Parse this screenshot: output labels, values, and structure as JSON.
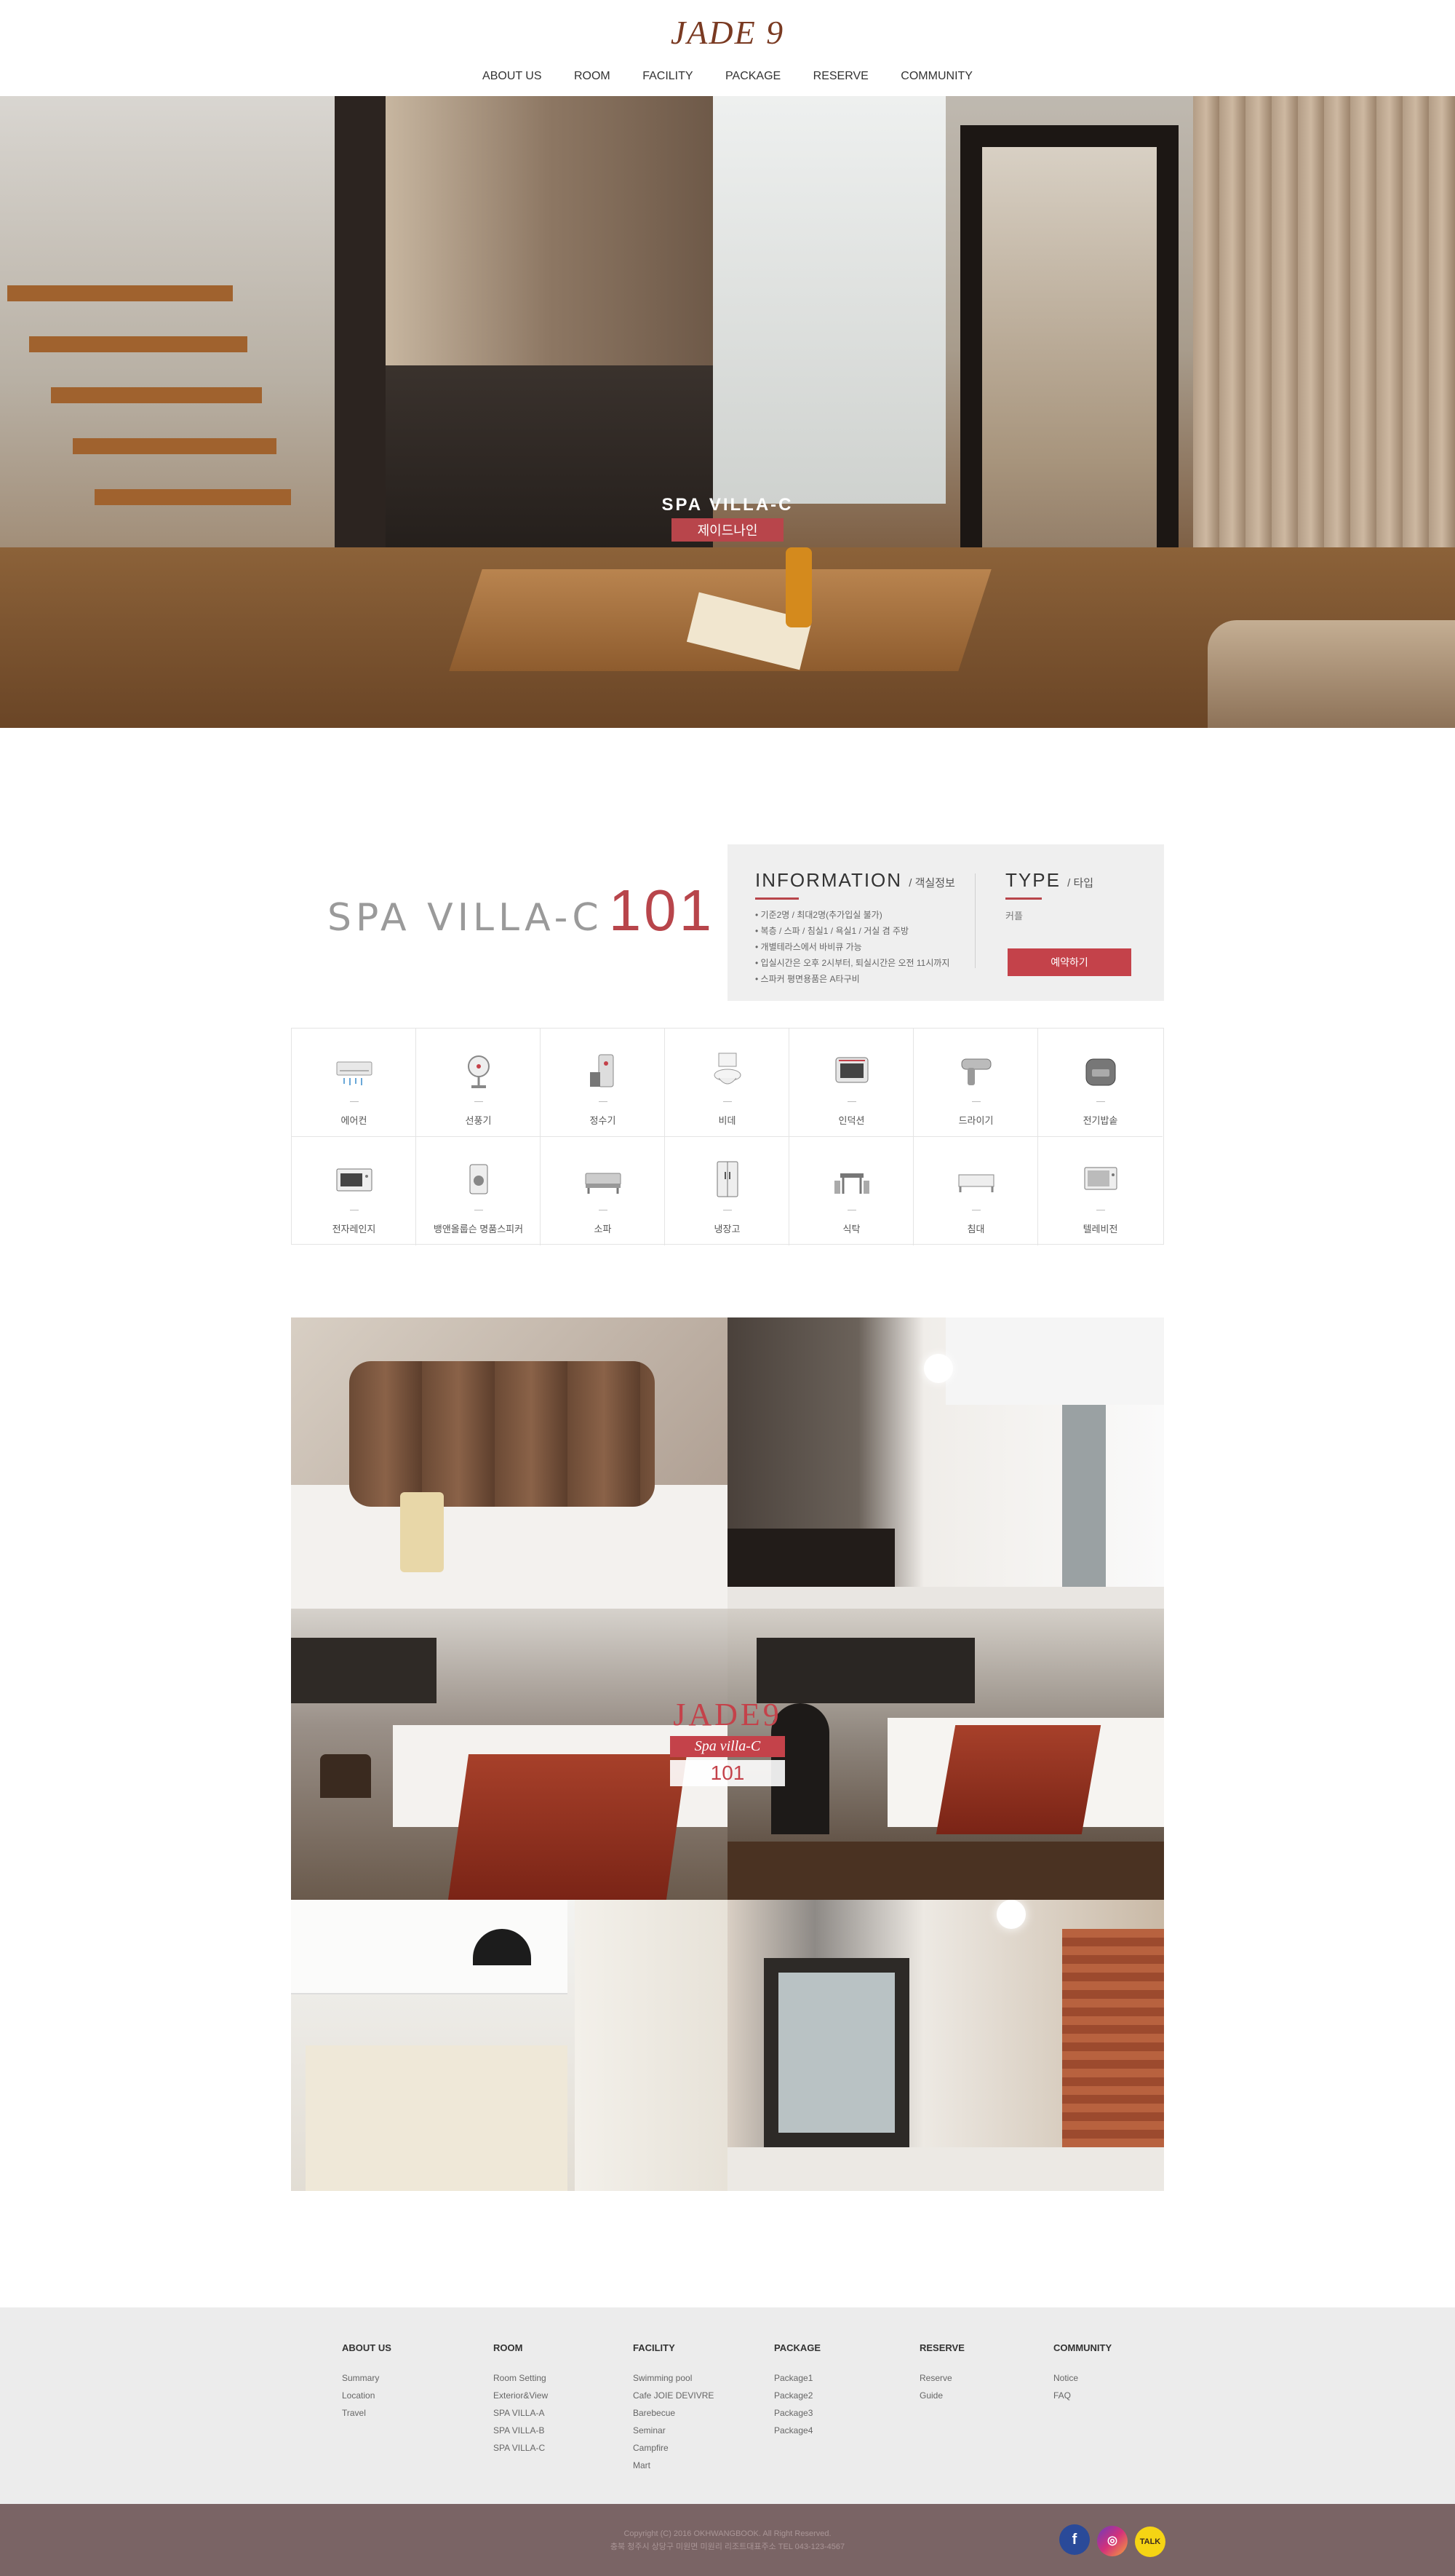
{
  "brand": {
    "logo": "JADE 9"
  },
  "nav": {
    "items": [
      "ABOUT US",
      "ROOM",
      "FACILITY",
      "PACKAGE",
      "RESERVE",
      "COMMUNITY"
    ]
  },
  "hero": {
    "title": "SPA VILLA-C",
    "subtitle": "제이드나인"
  },
  "room": {
    "name": "SPA VILLA-C",
    "number": "101",
    "info_title": "INFORMATION",
    "info_sub": "/ 객실정보",
    "info_items": [
      "• 기준2명 / 최대2명(추가입실 불가)",
      "• 복층 / 스파 / 침실1 / 욕실1 / 거실 겸 주방",
      "• 개별테라스에서 바비큐 가능",
      "• 입실시간은 오후 2시부터, 퇴실시간은 오전 11시까지",
      "• 스파커 평면용품은 A타구비"
    ],
    "type_title": "TYPE",
    "type_sub": "/ 타입",
    "type_value": "커플",
    "reserve_label": "예약하기"
  },
  "amenities": [
    {
      "icon": "air-conditioner-icon",
      "label": "에어컨"
    },
    {
      "icon": "fan-icon",
      "label": "선풍기"
    },
    {
      "icon": "water-purifier-icon",
      "label": "정수기"
    },
    {
      "icon": "bidet-icon",
      "label": "비데"
    },
    {
      "icon": "induction-icon",
      "label": "인덕션"
    },
    {
      "icon": "hair-dryer-icon",
      "label": "드라이기"
    },
    {
      "icon": "rice-cooker-icon",
      "label": "전기밥솥"
    },
    {
      "icon": "microwave-icon",
      "label": "전자레인지"
    },
    {
      "icon": "speaker-icon",
      "label": "뱅앤올룹슨 명품스피커"
    },
    {
      "icon": "sofa-icon",
      "label": "소파"
    },
    {
      "icon": "refrigerator-icon",
      "label": "냉장고"
    },
    {
      "icon": "dining-table-icon",
      "label": "식탁"
    },
    {
      "icon": "bed-icon",
      "label": "침대"
    },
    {
      "icon": "television-icon",
      "label": "텔레비전"
    }
  ],
  "gallery_logo": {
    "brand": "JADE9",
    "type": "Spa villa-C",
    "number": "101"
  },
  "footer": {
    "columns": [
      {
        "title": "ABOUT US",
        "items": [
          "Summary",
          "Location",
          "Travel"
        ]
      },
      {
        "title": "ROOM",
        "items": [
          "Room Setting",
          "Exterior&View",
          "SPA VILLA-A",
          "SPA VILLA-B",
          "SPA VILLA-C"
        ]
      },
      {
        "title": "FACILITY",
        "items": [
          "Swimming pool",
          "Cafe JOIE DEVIVRE",
          "Barebecue",
          "Seminar",
          "Campfire",
          "Mart"
        ]
      },
      {
        "title": "PACKAGE",
        "items": [
          "Package1",
          "Package2",
          "Package3",
          "Package4"
        ]
      },
      {
        "title": "RESERVE",
        "items": [
          "Reserve",
          "Guide"
        ]
      },
      {
        "title": "COMMUNITY",
        "items": [
          "Notice",
          "FAQ"
        ]
      }
    ],
    "copyright": "Copyright (C) 2016 OKHWANGBOOK. All Right Reserved.",
    "address": "충북 청주시 상당구 미원면 미원리 리조트대표주소 TEL 043-123-4567",
    "socials": [
      {
        "icon": "facebook-icon",
        "glyph": "f"
      },
      {
        "icon": "instagram-icon",
        "glyph": "◎"
      },
      {
        "icon": "kakaotalk-icon",
        "glyph": "TALK"
      }
    ]
  },
  "colors": {
    "accent": "#c4424a",
    "brand": "#7a3a22",
    "footer_bar": "#7a6465"
  }
}
